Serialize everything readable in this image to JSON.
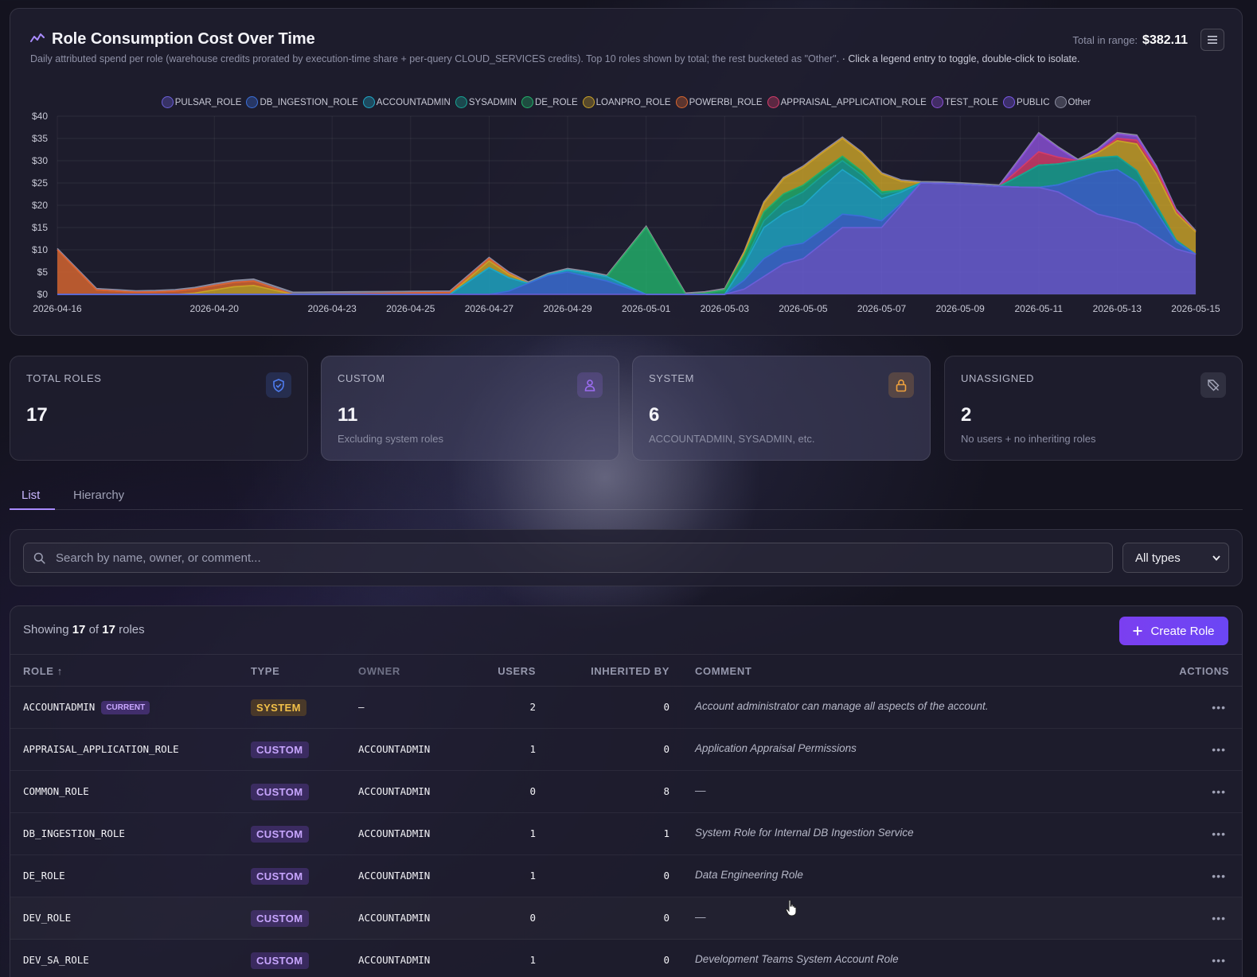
{
  "chart_panel": {
    "title": "Role Consumption Cost Over Time",
    "subtitle": "Daily attributed spend per role (warehouse credits prorated by execution-time share + per-query CLOUD_SERVICES credits). Top 10 roles shown by total; the rest bucketed as \"Other\".",
    "hint": "· Click a legend entry to toggle, double-click to isolate.",
    "total_label": "Total in range:",
    "total_value": "$382.11",
    "menu_icon": "hamburger-icon"
  },
  "chart_data": {
    "type": "area",
    "stacked": true,
    "x_tick_labels": [
      "2026-04-16",
      "2026-04-20",
      "2026-04-23",
      "2026-04-25",
      "2026-04-27",
      "2026-04-29",
      "2026-05-01",
      "2026-05-03",
      "2026-05-05",
      "2026-05-07",
      "2026-05-09",
      "2026-05-11",
      "2026-05-13",
      "2026-05-15"
    ],
    "x_range": [
      "2026-04-16",
      "2026-05-15"
    ],
    "y_tick_labels": [
      "$0",
      "$5",
      "$10",
      "$15",
      "$20",
      "$25",
      "$30",
      "$35",
      "$40"
    ],
    "ylim": [
      0,
      40
    ],
    "grid": true,
    "legend_position": "top-center",
    "series": [
      {
        "name": "PULSAR_ROLE",
        "color": "#6b5fd8",
        "points": [
          [
            "2026-04-16",
            0
          ],
          [
            "2026-05-03",
            0
          ],
          [
            "2026-05-05",
            8
          ],
          [
            "2026-05-06",
            15
          ],
          [
            "2026-05-07",
            15
          ],
          [
            "2026-05-08",
            25
          ],
          [
            "2026-05-11",
            24
          ],
          [
            "2026-05-13",
            17
          ],
          [
            "2026-05-15",
            9
          ]
        ]
      },
      {
        "name": "DB_INGESTION_ROLE",
        "color": "#3b6fd8",
        "points": [
          [
            "2026-04-16",
            0
          ],
          [
            "2026-04-27",
            0
          ],
          [
            "2026-04-29",
            5
          ],
          [
            "2026-04-30",
            3
          ],
          [
            "2026-05-01",
            0
          ],
          [
            "2026-05-03",
            0
          ],
          [
            "2026-05-04",
            4
          ],
          [
            "2026-05-06",
            3
          ],
          [
            "2026-05-08",
            0
          ],
          [
            "2026-05-11",
            0
          ],
          [
            "2026-05-13",
            11
          ],
          [
            "2026-05-15",
            0
          ]
        ]
      },
      {
        "name": "ACCOUNTADMIN",
        "color": "#1fa7c6",
        "points": [
          [
            "2026-04-16",
            0
          ],
          [
            "2026-04-26",
            0
          ],
          [
            "2026-04-27",
            6
          ],
          [
            "2026-04-28",
            0
          ],
          [
            "2026-04-30",
            1
          ],
          [
            "2026-05-01",
            0
          ],
          [
            "2026-05-03",
            0
          ],
          [
            "2026-05-04",
            7
          ],
          [
            "2026-05-06",
            10
          ],
          [
            "2026-05-07",
            5
          ],
          [
            "2026-05-08",
            0
          ],
          [
            "2026-05-15",
            0
          ]
        ]
      },
      {
        "name": "SYSADMIN",
        "color": "#18a394",
        "points": [
          [
            "2026-04-16",
            0
          ],
          [
            "2026-05-03",
            0
          ],
          [
            "2026-05-05",
            3
          ],
          [
            "2026-05-06",
            2
          ],
          [
            "2026-05-08",
            0
          ],
          [
            "2026-05-10",
            0
          ],
          [
            "2026-05-11",
            5
          ],
          [
            "2026-05-13",
            3
          ],
          [
            "2026-05-15",
            0
          ]
        ]
      },
      {
        "name": "DE_ROLE",
        "color": "#22b06a",
        "points": [
          [
            "2026-04-16",
            0
          ],
          [
            "2026-04-30",
            0
          ],
          [
            "2026-05-01",
            15
          ],
          [
            "2026-05-02",
            0
          ],
          [
            "2026-05-04",
            2
          ],
          [
            "2026-05-06",
            1
          ],
          [
            "2026-05-08",
            0
          ],
          [
            "2026-05-15",
            0
          ]
        ]
      },
      {
        "name": "LOANPRO_ROLE",
        "color": "#c9a227",
        "points": [
          [
            "2026-04-16",
            0
          ],
          [
            "2026-04-19",
            0
          ],
          [
            "2026-04-21",
            2
          ],
          [
            "2026-04-22",
            0
          ],
          [
            "2026-04-26",
            0
          ],
          [
            "2026-04-27",
            1.5
          ],
          [
            "2026-04-28",
            0
          ],
          [
            "2026-05-03",
            0
          ],
          [
            "2026-05-05",
            4
          ],
          [
            "2026-05-07",
            4
          ],
          [
            "2026-05-08",
            0
          ],
          [
            "2026-05-12",
            0
          ],
          [
            "2026-05-14",
            7
          ],
          [
            "2026-05-15",
            5
          ]
        ]
      },
      {
        "name": "POWERBI_ROLE",
        "color": "#d9662f",
        "points": [
          [
            "2026-04-16",
            10
          ],
          [
            "2026-04-17",
            1
          ],
          [
            "2026-04-18",
            0.5
          ],
          [
            "2026-04-20",
            1
          ],
          [
            "2026-04-21",
            1
          ],
          [
            "2026-04-22",
            0
          ],
          [
            "2026-04-27",
            0.5
          ],
          [
            "2026-04-28",
            0
          ],
          [
            "2026-05-15",
            0
          ]
        ]
      },
      {
        "name": "APPRAISAL_APPLICATION_ROLE",
        "color": "#d43c6a",
        "points": [
          [
            "2026-04-16",
            0
          ],
          [
            "2026-05-10",
            0
          ],
          [
            "2026-05-11",
            3
          ],
          [
            "2026-05-12",
            0
          ],
          [
            "2026-05-14",
            1
          ],
          [
            "2026-05-15",
            0
          ]
        ]
      },
      {
        "name": "TEST_ROLE",
        "color": "#8a4fd6",
        "points": [
          [
            "2026-04-16",
            0
          ],
          [
            "2026-05-10",
            0
          ],
          [
            "2026-05-11",
            4
          ],
          [
            "2026-05-12",
            0
          ],
          [
            "2026-05-13",
            1
          ],
          [
            "2026-05-15",
            0
          ]
        ]
      },
      {
        "name": "PUBLIC",
        "color": "#7a58e6",
        "points": [
          [
            "2026-04-16",
            0
          ],
          [
            "2026-05-15",
            0
          ]
        ]
      },
      {
        "name": "Other",
        "color": "#8b8da0",
        "points": [
          [
            "2026-04-16",
            0.3
          ],
          [
            "2026-04-18",
            0.3
          ],
          [
            "2026-04-23",
            0.5
          ],
          [
            "2026-04-26",
            0.3
          ],
          [
            "2026-05-03",
            0.3
          ],
          [
            "2026-05-15",
            0.3
          ]
        ]
      }
    ]
  },
  "stats": [
    {
      "label": "TOTAL ROLES",
      "value": "17",
      "desc": "",
      "icon": "shield-check-icon",
      "color": "#4f7df0"
    },
    {
      "label": "CUSTOM",
      "value": "11",
      "desc": "Excluding system roles",
      "icon": "user-icon",
      "color": "#9b6cf0"
    },
    {
      "label": "SYSTEM",
      "value": "6",
      "desc": "ACCOUNTADMIN, SYSADMIN, etc.",
      "icon": "lock-icon",
      "color": "#f0a13c"
    },
    {
      "label": "UNASSIGNED",
      "value": "2",
      "desc": "No users + no inheriting roles",
      "icon": "tag-off-icon",
      "color": "#a3a5b8"
    }
  ],
  "tabs": [
    {
      "label": "List",
      "active": true
    },
    {
      "label": "Hierarchy",
      "active": false
    }
  ],
  "search": {
    "placeholder": "Search by name, owner, or comment...",
    "value": "",
    "type_filter": "All types"
  },
  "table": {
    "showing_prefix": "Showing",
    "showing_count": "17",
    "showing_of": "of",
    "showing_total": "17",
    "showing_suffix": "roles",
    "create_label": "Create Role",
    "columns": {
      "role": "ROLE ↑",
      "type": "TYPE",
      "owner": "OWNER",
      "users": "USERS",
      "inherited_by": "INHERITED BY",
      "comment": "COMMENT",
      "actions": "ACTIONS"
    },
    "current_badge": "CURRENT",
    "rows": [
      {
        "role": "ACCOUNTADMIN",
        "current": true,
        "type": "SYSTEM",
        "owner": "—",
        "users": "2",
        "inherited_by": "0",
        "comment": "Account administrator can manage all aspects of the account."
      },
      {
        "role": "APPRAISAL_APPLICATION_ROLE",
        "current": false,
        "type": "CUSTOM",
        "owner": "ACCOUNTADMIN",
        "users": "1",
        "inherited_by": "0",
        "comment": "Application Appraisal Permissions"
      },
      {
        "role": "COMMON_ROLE",
        "current": false,
        "type": "CUSTOM",
        "owner": "ACCOUNTADMIN",
        "users": "0",
        "inherited_by": "8",
        "comment": "—"
      },
      {
        "role": "DB_INGESTION_ROLE",
        "current": false,
        "type": "CUSTOM",
        "owner": "ACCOUNTADMIN",
        "users": "1",
        "inherited_by": "1",
        "comment": "System Role for Internal DB Ingestion Service"
      },
      {
        "role": "DE_ROLE",
        "current": false,
        "type": "CUSTOM",
        "owner": "ACCOUNTADMIN",
        "users": "1",
        "inherited_by": "0",
        "comment": "Data Engineering Role"
      },
      {
        "role": "DEV_ROLE",
        "current": false,
        "type": "CUSTOM",
        "owner": "ACCOUNTADMIN",
        "users": "0",
        "inherited_by": "0",
        "comment": "—"
      },
      {
        "role": "DEV_SA_ROLE",
        "current": false,
        "type": "CUSTOM",
        "owner": "ACCOUNTADMIN",
        "users": "1",
        "inherited_by": "0",
        "comment": "Development Teams System Account Role"
      }
    ]
  }
}
